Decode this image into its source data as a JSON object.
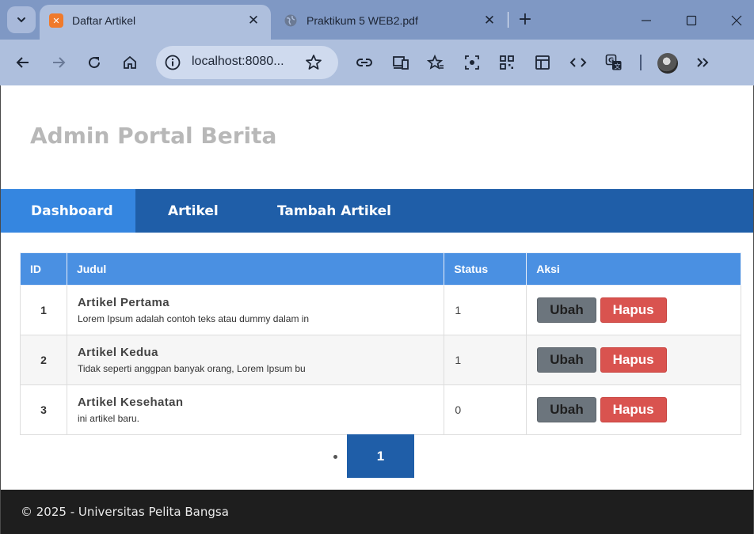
{
  "browser": {
    "tabs": [
      {
        "title": "Daftar Artikel",
        "favicon": "xampp-icon",
        "active": true
      },
      {
        "title": "Praktikum 5 WEB2.pdf",
        "favicon": "globe-icon",
        "active": false
      }
    ],
    "url": "localhost:8080...",
    "toolbar_icons": [
      "back-icon",
      "forward-icon",
      "reload-icon",
      "home-icon",
      "site-info-icon",
      "bookmark-star-icon",
      "link-icon",
      "devices-icon",
      "favorites-icon",
      "screenshot-icon",
      "qr-code-icon",
      "reader-icon",
      "code-icon",
      "translate-icon",
      "profile-avatar",
      "more-chevrons-icon"
    ],
    "colors": {
      "tabstrip": "#7f98c4",
      "toolbar": "#aebfdd"
    }
  },
  "site": {
    "title": "Admin Portal Berita"
  },
  "nav": {
    "items": [
      {
        "label": "Dashboard",
        "active": true
      },
      {
        "label": "Artikel",
        "active": false
      },
      {
        "label": "Tambah Artikel",
        "active": false
      }
    ],
    "colors": {
      "bar": "#1f5ea8",
      "active": "#3586e0"
    }
  },
  "table": {
    "headers": {
      "id": "ID",
      "judul": "Judul",
      "status": "Status",
      "aksi": "Aksi"
    },
    "rows": [
      {
        "id": "1",
        "title": "Artikel Pertama",
        "excerpt": "Lorem Ipsum adalah contoh teks atau dummy dalam in",
        "status": "1",
        "edit_label": "Ubah",
        "delete_label": "Hapus"
      },
      {
        "id": "2",
        "title": "Artikel Kedua",
        "excerpt": "Tidak seperti anggpan banyak orang, Lorem Ipsum bu",
        "status": "1",
        "edit_label": "Ubah",
        "delete_label": "Hapus"
      },
      {
        "id": "3",
        "title": "Artikel Kesehatan",
        "excerpt": "ini artikel baru.",
        "status": "0",
        "edit_label": "Ubah",
        "delete_label": "Hapus"
      }
    ],
    "colors": {
      "header": "#4a90e2",
      "edit_button": "#6c757d",
      "delete_button": "#d9534f"
    }
  },
  "pagination": {
    "current_page": "1"
  },
  "footer": {
    "text": "© 2025 - Universitas Pelita Bangsa"
  }
}
